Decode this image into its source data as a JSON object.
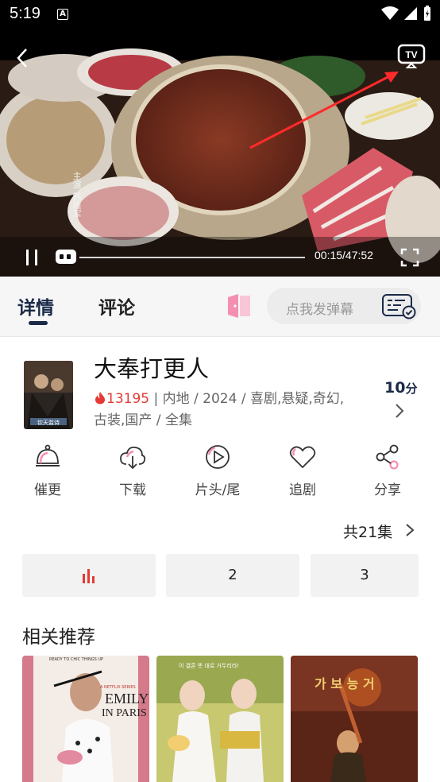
{
  "status_bar": {
    "time": "5:19",
    "a_badge": "A"
  },
  "player": {
    "time_display": "00:15/47:52",
    "progress": 0.005,
    "overlay_text": "主演 韩维军",
    "tv_label": "TV"
  },
  "tabs": {
    "detail": "详情",
    "comments": "评论"
  },
  "danmaku": {
    "placeholder": "点我发弹幕"
  },
  "show": {
    "title": "大奉打更人",
    "hot_count": "13195",
    "meta_line1": " | 内地 / 2024 / 喜剧,悬疑,奇幻,",
    "meta_line2": "古装,国产 / 全集",
    "score_value": "10",
    "score_unit": "分",
    "poster_text": "钦天监诗"
  },
  "actions": [
    {
      "label": "催更",
      "icon": "bell-icon"
    },
    {
      "label": "下载",
      "icon": "cloud-download-icon"
    },
    {
      "label": "片头/尾",
      "icon": "play-circle-icon"
    },
    {
      "label": "追剧",
      "icon": "heart-icon"
    },
    {
      "label": "分享",
      "icon": "share-icon"
    }
  ],
  "episodes": {
    "total_label": "共21集",
    "items": [
      "2",
      "3"
    ]
  },
  "recommendations": {
    "heading": "相关推荐",
    "items": [
      {
        "top_text": "READY TO CHIC THINGS UP",
        "badge": "A NETFLIX SERIES",
        "title_line1": "EMILY",
        "title_line2": "IN PARIS"
      },
      {
        "top_text": "이 결혼 뜻 대로 거두리라!"
      },
      {
        "top_text": "가 보 능 거"
      }
    ]
  },
  "colors": {
    "accent_red": "#e53935",
    "navy": "#1b2a48",
    "pink": "#f48fb1"
  }
}
